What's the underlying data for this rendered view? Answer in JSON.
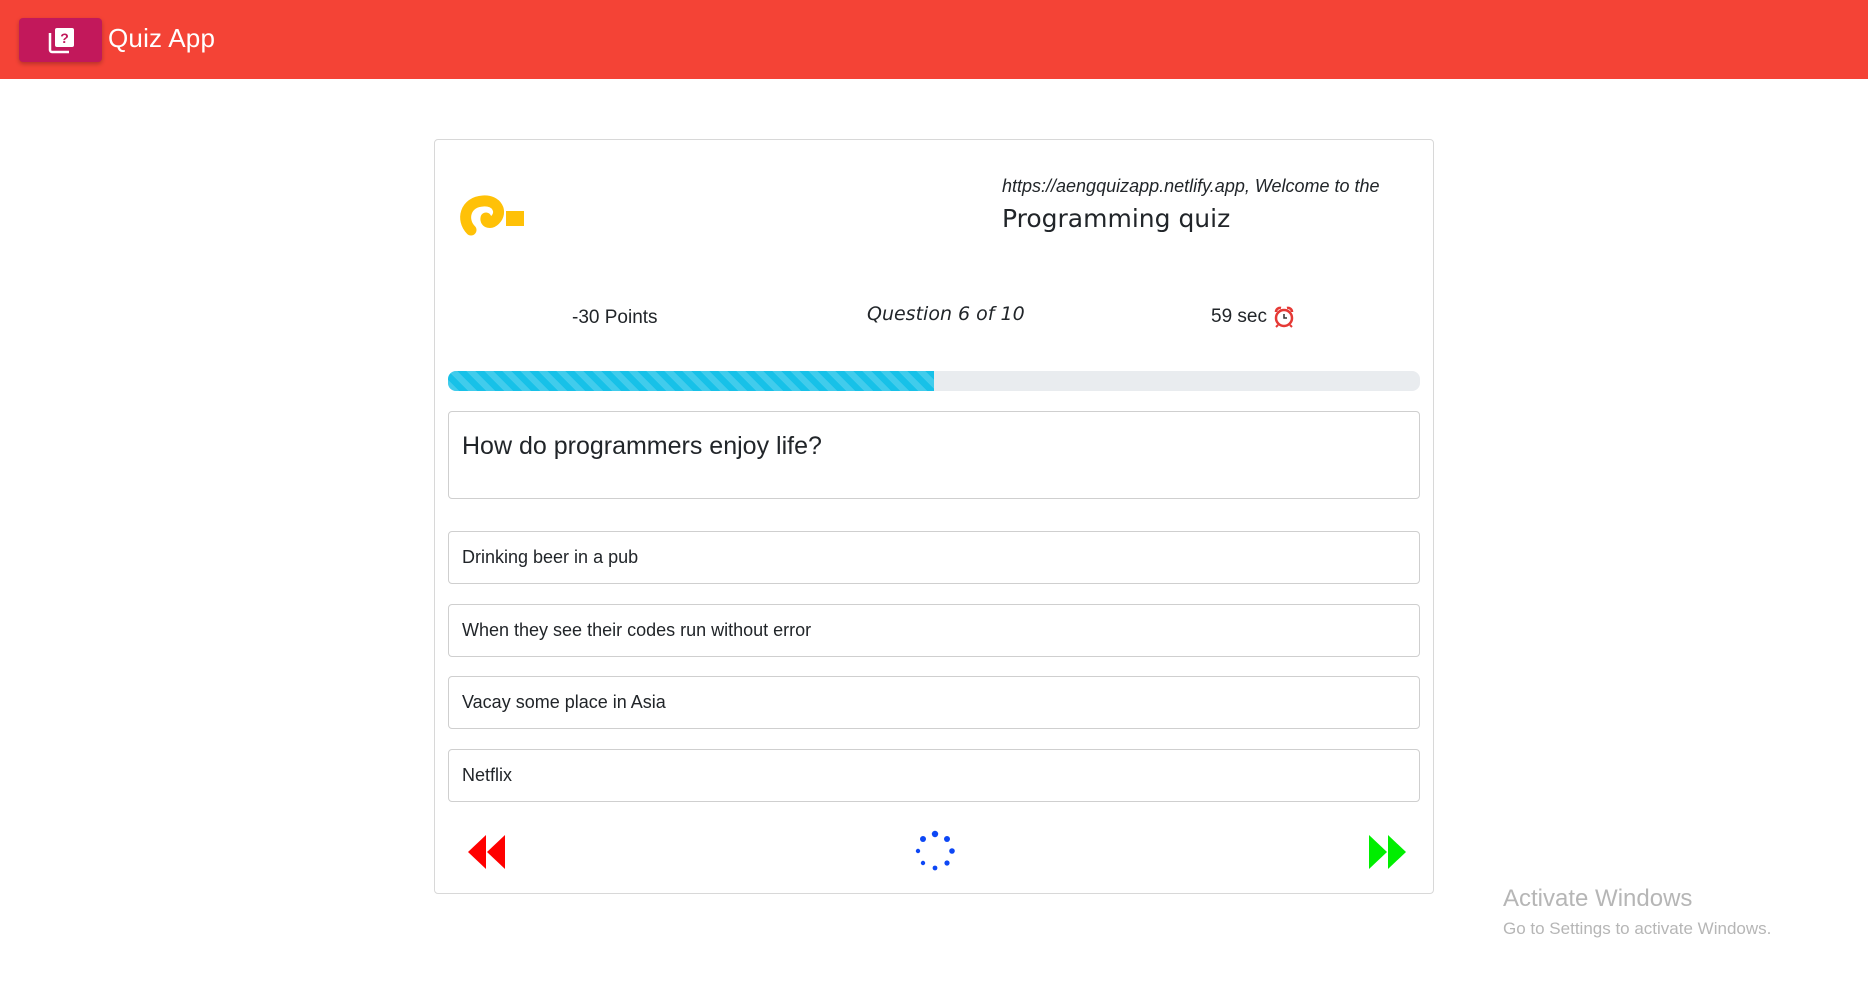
{
  "header": {
    "app_title": "Quiz App",
    "brand_icon": "quiz-icon",
    "color": "#f44336",
    "brand_button_color": "#c2185b"
  },
  "quiz": {
    "welcome_url": "https://aengquizapp.netlify.app, Welcome to the",
    "quiz_title": "Programming quiz",
    "points_label": "-30 Points",
    "question_counter": "Question 6 of 10",
    "timer_label": "59 sec",
    "timer_icon": "alarm-clock-icon",
    "progress_fraction": 0.5,
    "question": "How do programmers enjoy life?",
    "options": [
      "Drinking beer in a pub",
      "When they see their codes run without error",
      "Vacay some place in Asia",
      "Netflix"
    ],
    "prev_icon": "rewind-icon",
    "next_icon": "fast-forward-icon",
    "loading_icon": "spinner-icon",
    "colors": {
      "progress": "#17c1e8",
      "prev": "#ff0000",
      "next": "#00ee00",
      "spinner": "#0d47f5",
      "logo": "#ffc107"
    }
  },
  "os_watermark": {
    "title": "Activate Windows",
    "subtitle": "Go to Settings to activate Windows."
  }
}
